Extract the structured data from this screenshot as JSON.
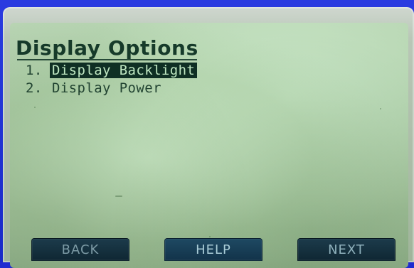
{
  "screen": {
    "title": "Display Options",
    "menu_items": [
      {
        "number": "1.",
        "label": "Display Backlight",
        "selected": true
      },
      {
        "number": "2.",
        "label": "Display Power",
        "selected": false
      }
    ]
  },
  "softkeys": {
    "back": "BACK",
    "help": "HELP",
    "next": "NEXT"
  },
  "colors": {
    "lcd_background": "#a8c8a2",
    "lcd_text": "#163a2a",
    "selection_background": "#0f2f24",
    "selection_text": "#bfe7c2",
    "softkey_background": "#12334a",
    "softkey_text": "#a9ccd7",
    "device_frame": "#1f2bd0"
  }
}
